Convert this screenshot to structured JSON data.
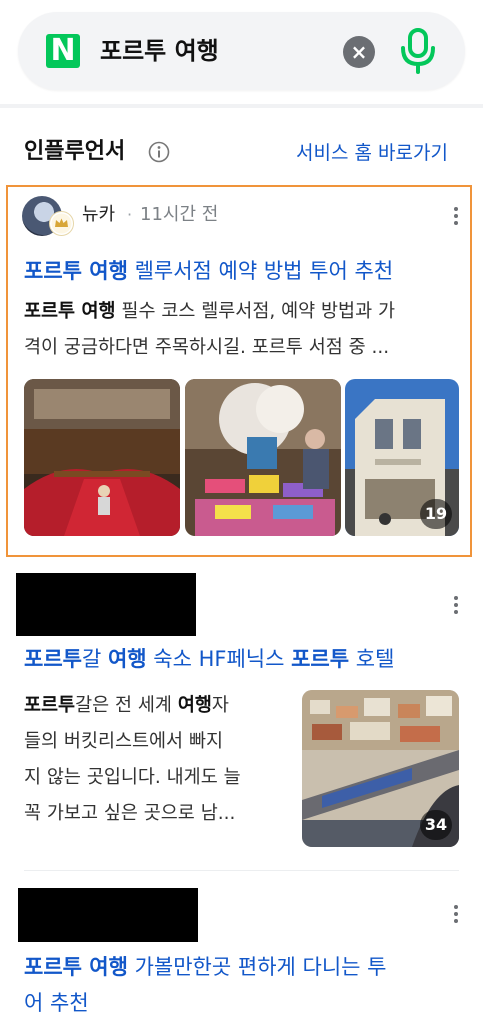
{
  "search": {
    "logo": "N",
    "query": "포르투 여행",
    "clear_icon": "close-icon",
    "mic_icon": "microphone-icon"
  },
  "section": {
    "title": "인플루언서",
    "info_icon": "info-icon",
    "link": "서비스 홈 바로가기"
  },
  "posts": [
    {
      "author": "뉴카",
      "separator": "·",
      "time": "11시간 전",
      "title_bold": "포르투 여행",
      "title_rest": " 렐루서점 예약 방법 투어 추천",
      "snippet_bold": "포르투 여행",
      "snippet_line1_rest": " 필수 코스 렐루서점, 예약 방법과 가",
      "snippet_line2": "격이 궁금하다면 주목하시길. 포르투 서점 중 ...",
      "image_count": "19"
    },
    {
      "title_parts": [
        "포르투",
        "갈 ",
        "여행",
        " 숙소 HF페닉스 ",
        "포르투",
        " 호텔"
      ],
      "snippet_lines": [
        [
          "포르투",
          "갈은 전 세계 ",
          "여행",
          "자"
        ],
        [
          "",
          "들의 버킷리스트에서 빠지",
          "",
          ""
        ],
        [
          "",
          "지 않는 곳입니다. 내게도 늘",
          "",
          ""
        ],
        [
          "",
          "꼭 가보고 싶은 곳으로 남...",
          "",
          ""
        ]
      ],
      "image_count": "34"
    },
    {
      "title_line1_bold": "포르투 여행",
      "title_line1_rest": " 가볼만한곳 편하게 다니는 투",
      "title_line2": "어 추천"
    }
  ],
  "colors": {
    "brand_green": "#03c75a",
    "link_blue": "#1257c9",
    "highlight_orange": "#f0943a"
  }
}
